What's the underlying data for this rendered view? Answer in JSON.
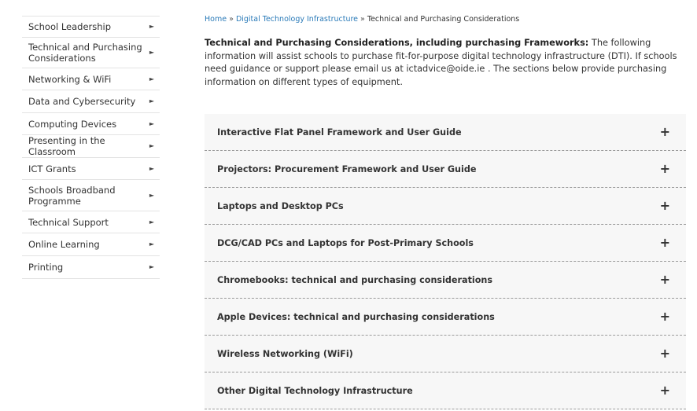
{
  "sidebar": {
    "items": [
      {
        "label": "School Leadership"
      },
      {
        "label": "Technical and Purchasing Considerations"
      },
      {
        "label": "Networking & WiFi"
      },
      {
        "label": "Data and Cybersecurity"
      },
      {
        "label": "Computing Devices"
      },
      {
        "label": "Presenting in the Classroom"
      },
      {
        "label": "ICT Grants"
      },
      {
        "label": "Schools Broadband Programme"
      },
      {
        "label": "Technical Support"
      },
      {
        "label": "Online Learning"
      },
      {
        "label": "Printing"
      }
    ],
    "arrow_glyph": "►"
  },
  "breadcrumb": {
    "home": "Home",
    "separator": "»",
    "parent": "Digital Technology Infrastructure",
    "current": "Technical and Purchasing Considerations"
  },
  "intro": {
    "heading": "Technical and Purchasing Considerations, including purchasing Frameworks:",
    "text_before_email": " The following information will assist schools to purchase fit-for-purpose digital technology infrastructure (DTI). If schools need guidance or support please email us at ",
    "email": "ictadvice@oide.ie",
    "text_after_email": " . The sections below provide purchasing information on different types of equipment."
  },
  "accordion": {
    "items": [
      {
        "title": "Interactive Flat Panel Framework and User Guide"
      },
      {
        "title": "Projectors: Procurement Framework and User Guide"
      },
      {
        "title": "Laptops and Desktop PCs"
      },
      {
        "title": "DCG/CAD PCs and Laptops for Post-Primary Schools"
      },
      {
        "title": "Chromebooks: technical and purchasing considerations"
      },
      {
        "title": "Apple Devices: technical and purchasing considerations"
      },
      {
        "title": "Wireless Networking (WiFi)"
      },
      {
        "title": "Other Digital Technology Infrastructure"
      }
    ],
    "expand_glyph": "+"
  },
  "colors": {
    "link": "#2a7ab8",
    "text": "#333333",
    "accordion_bg": "#f7f7f7"
  }
}
